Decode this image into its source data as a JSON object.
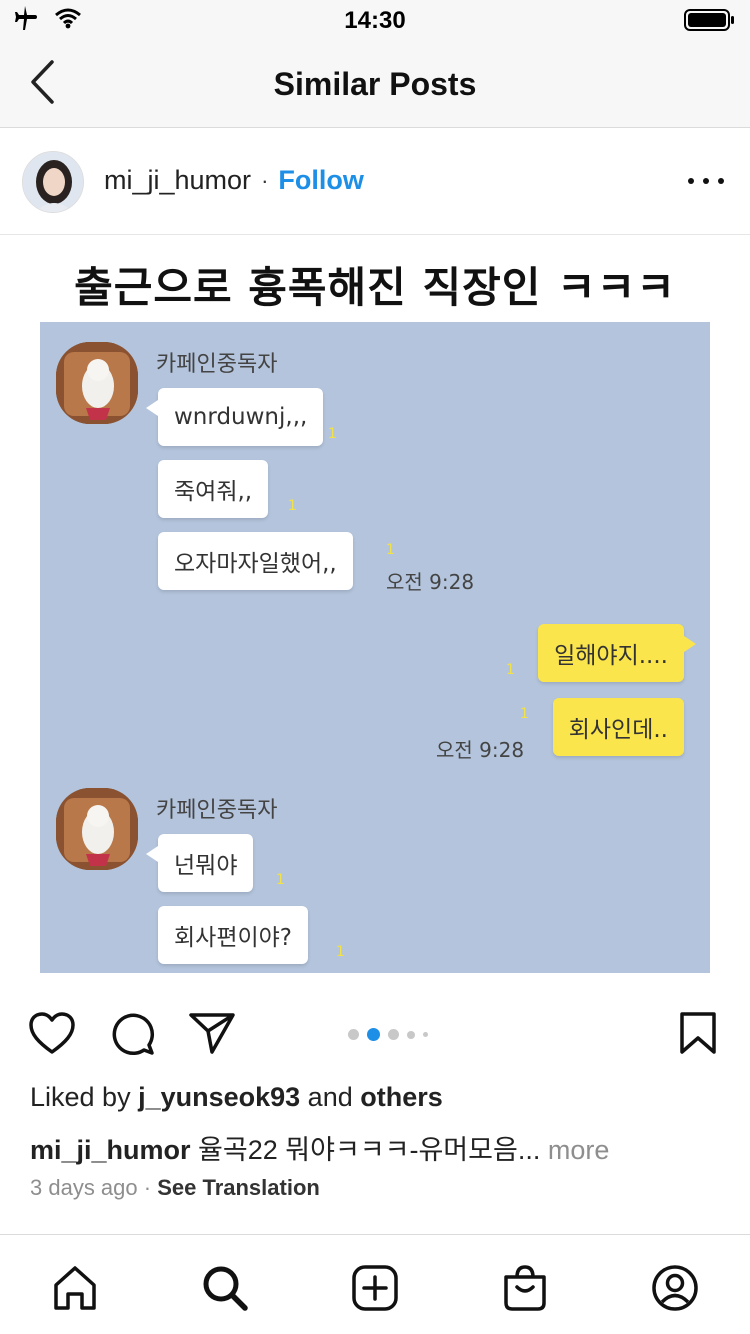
{
  "status_bar": {
    "time": "14:30"
  },
  "nav": {
    "title": "Similar Posts"
  },
  "post": {
    "username": "mi_ji_humor",
    "separator": "·",
    "follow_label": "Follow",
    "image": {
      "title": "출근으로 흉폭해진 직장인 ㅋㅋㅋ",
      "chat": {
        "sender_name_1": "카페인중독자",
        "messages_1": [
          "wnrduwnj,,,",
          "죽여줘,,",
          "오자마자일했어,,"
        ],
        "read_mark": "1",
        "time_1": "오전 9:28",
        "my_messages": [
          "일해야지....",
          "회사인데.."
        ],
        "time_2": "오전 9:28",
        "sender_name_2": "카페인중독자",
        "messages_2": [
          "넌뭐야",
          "회사편이야?"
        ]
      }
    },
    "carousel": {
      "total": 5,
      "active": 1
    },
    "likes": {
      "prefix": "Liked by ",
      "user": "j_yunseok93",
      "middle": " and ",
      "others": "others"
    },
    "caption": {
      "username": "mi_ji_humor",
      "text": " 율곡22  뭐야ㅋㅋㅋ-유머모음...",
      "more": "more"
    },
    "meta": {
      "time": "3 days ago",
      "dot": "·",
      "see_translation": "See Translation"
    }
  },
  "colors": {
    "follow": "#1d8fe6",
    "chat_bg": "#b3c4dc",
    "my_bubble": "#fbe54c"
  },
  "icons": {
    "status": [
      "airplane-icon",
      "wifi-icon",
      "battery-icon"
    ],
    "actions": [
      "heart-icon",
      "comment-icon",
      "share-icon",
      "bookmark-icon"
    ],
    "tabs": [
      "home-icon",
      "search-icon",
      "create-icon",
      "shop-icon",
      "profile-icon"
    ]
  }
}
